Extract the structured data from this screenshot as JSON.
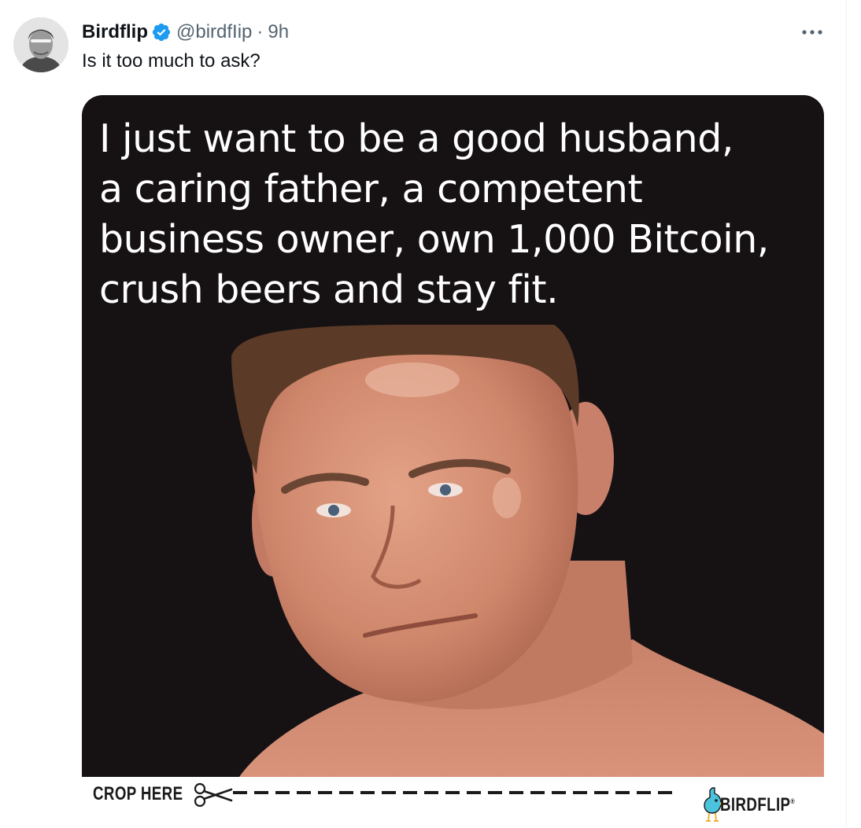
{
  "tweet": {
    "display_name": "Birdflip",
    "handle": "@birdfIip",
    "separator": "·",
    "time": "9h",
    "text": "Is it too much to ask?",
    "more_icon": "ellipsis-icon",
    "verified_icon": "verified-badge-icon",
    "colors": {
      "verified": "#1d9bf0",
      "secondary_text": "#536471"
    }
  },
  "meme": {
    "caption_lines": [
      "I just want to be a good husband,",
      "a caring father, a competent",
      "business owner, own 1,000 Bitcoin,",
      "crush beers and stay fit."
    ],
    "photo": "man-portrait-photo",
    "background": "#161113",
    "footer": {
      "crop_label": "CROP HERE",
      "scissors_icon": "scissors-icon",
      "brand": "BIRDFLIP",
      "brand_mark": "®",
      "brand_icon": "bird-logo-icon"
    }
  }
}
